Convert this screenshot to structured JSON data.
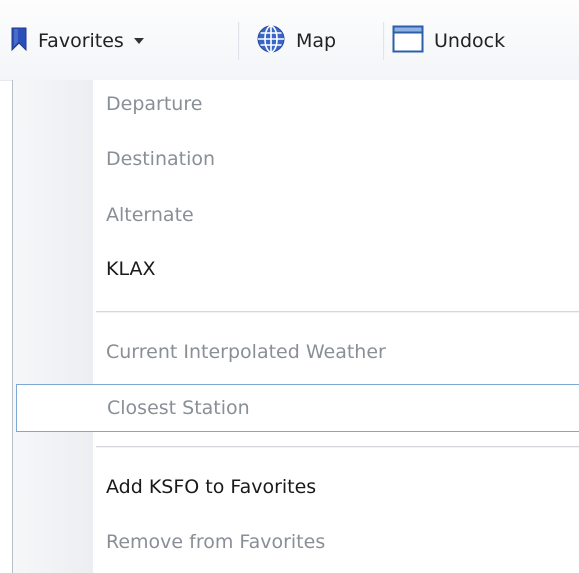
{
  "toolbar": {
    "favorites_label": "Favorites",
    "map_label": "Map",
    "undock_label": "Undock"
  },
  "icons": {
    "favorites": "bookmark-icon",
    "map": "globe-icon",
    "undock": "window-icon"
  },
  "colors": {
    "bookmark": "#2a4fb8",
    "hover_border": "#7fa8d3",
    "muted_text": "#8a8f96"
  },
  "menu": {
    "items": [
      {
        "label": "Departure"
      },
      {
        "label": "Destination"
      },
      {
        "label": "Alternate"
      },
      {
        "label": "KLAX"
      },
      {
        "label": "Current Interpolated Weather"
      },
      {
        "label": "Closest Station"
      },
      {
        "label": "Add KSFO to Favorites"
      },
      {
        "label": "Remove from Favorites"
      }
    ]
  }
}
